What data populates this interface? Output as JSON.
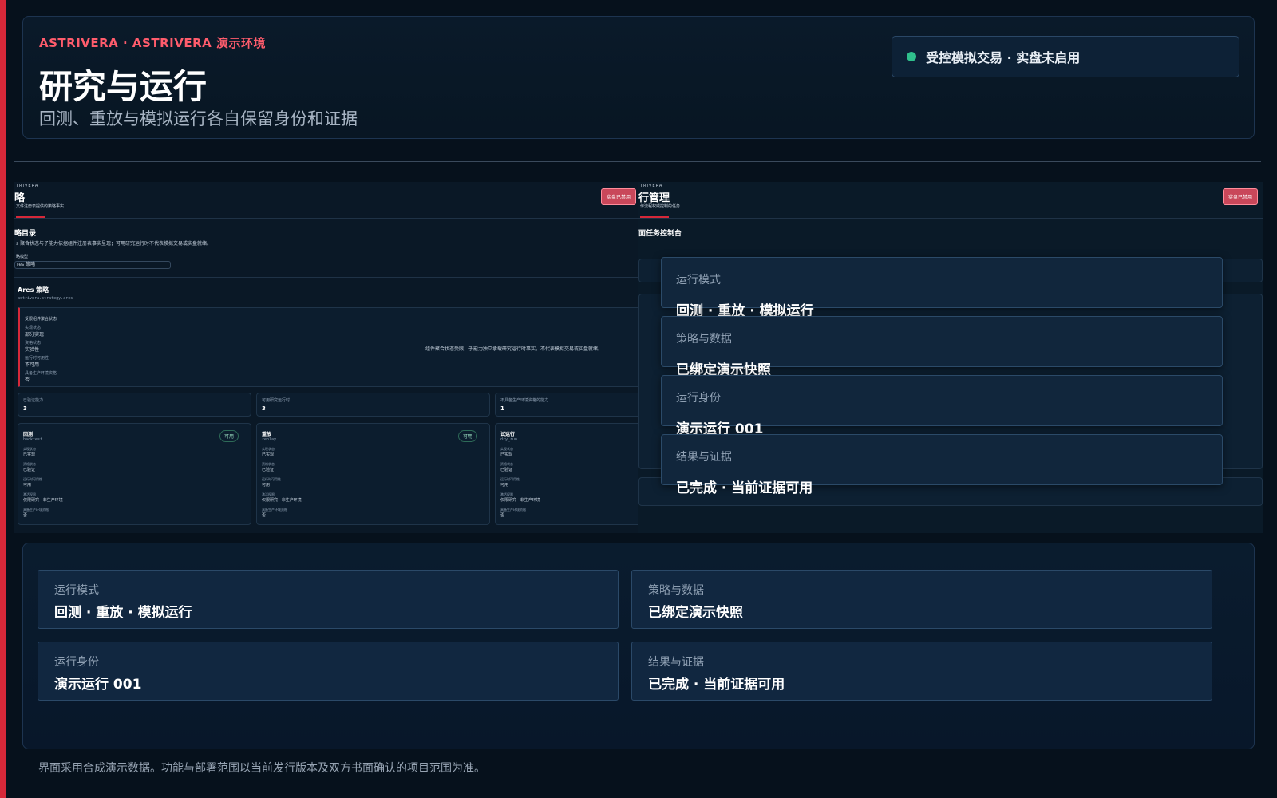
{
  "header": {
    "eyebrow": "ASTRIVERA · ASTRIVERA 演示环境",
    "title": "研究与运行",
    "subtitle": "回测、重放与模拟运行各自保留身份和证据",
    "status": "受控模拟交易 · 实盘未启用",
    "status_color": "#2fbf8c"
  },
  "left_shot": {
    "brand": "TRIVERA",
    "title": "略",
    "subtitle": "文件注册表提供的策略事实",
    "badge": "实盘已禁用",
    "section_title": "略目录",
    "section_desc": "s 聚合状态与子能力依据组件注册表事实呈现；可用研究运行时不代表模拟交易或实盘就绪。",
    "select_label": "略模型",
    "select_value": "res 策略",
    "strategy_name": "Ares 策略",
    "strategy_id": "astrivera.strategy.ares",
    "warn_title": "受限组件聚合状态",
    "warn_rows": [
      {
        "label": "实现状态",
        "value": "部分实现"
      },
      {
        "label": "资格状态",
        "value": "实验性"
      },
      {
        "label": "运行时可用性",
        "value": "不可用"
      },
      {
        "label": "具备生产环境资格",
        "value": "否"
      }
    ],
    "warn_note": "组件聚合状态受限；子能力独立承载研究运行时事实，不代表模拟交易或实盘就绪。",
    "stats": [
      {
        "label": "已验证能力",
        "value": "3"
      },
      {
        "label": "可用研究运行时",
        "value": "3"
      },
      {
        "label": "不具备生产环境资格的能力",
        "value": "1"
      }
    ],
    "capabilities": [
      {
        "name": "回测",
        "id": "backtest",
        "chip": "可用",
        "rows": [
          [
            "实现状态",
            "已实现"
          ],
          [
            "资格状态",
            "已验证"
          ],
          [
            "运行时可用性",
            "可用"
          ],
          [
            "激活权限",
            "仅限研究 · 非生产环境"
          ],
          [
            "具备生产环境资格",
            "否"
          ]
        ]
      },
      {
        "name": "重放",
        "id": "replay",
        "chip": "可用",
        "rows": [
          [
            "实现状态",
            "已实现"
          ],
          [
            "资格状态",
            "已验证"
          ],
          [
            "运行时可用性",
            "可用"
          ],
          [
            "激活权限",
            "仅限研究 · 非生产环境"
          ],
          [
            "具备生产环境资格",
            "否"
          ]
        ]
      },
      {
        "name": "试运行",
        "id": "dry_run",
        "chip": "",
        "rows": [
          [
            "实现状态",
            "已实现"
          ],
          [
            "资格状态",
            "已验证"
          ],
          [
            "运行时可用性",
            "可用"
          ],
          [
            "激活权限",
            "仅限研究 · 非生产环境"
          ],
          [
            "具备生产环境资格",
            "否"
          ]
        ]
      }
    ]
  },
  "right_shot": {
    "brand": "TRIVERA",
    "title": "行管理",
    "subtitle": "作流程权威控制的任务",
    "badge": "实盘已禁用",
    "section_title": "面任务控制台"
  },
  "overlay_cards": [
    {
      "label": "运行模式",
      "value": "回测 · 重放 · 模拟运行"
    },
    {
      "label": "策略与数据",
      "value": "已绑定演示快照"
    },
    {
      "label": "运行身份",
      "value": "演示运行 001"
    },
    {
      "label": "结果与证据",
      "value": "已完成 · 当前证据可用"
    }
  ],
  "summary": [
    {
      "label": "运行模式",
      "value": "回测 · 重放 · 模拟运行"
    },
    {
      "label": "策略与数据",
      "value": "已绑定演示快照"
    },
    {
      "label": "运行身份",
      "value": "演示运行 001"
    },
    {
      "label": "结果与证据",
      "value": "已完成 · 当前证据可用"
    }
  ],
  "footnote": "界面采用合成演示数据。功能与部署范围以当前发行版本及双方书面确认的项目范围为准。",
  "colors": {
    "accent": "#d62839",
    "eyebrow": "#ff5c6c",
    "ok": "#2fbf8c"
  }
}
